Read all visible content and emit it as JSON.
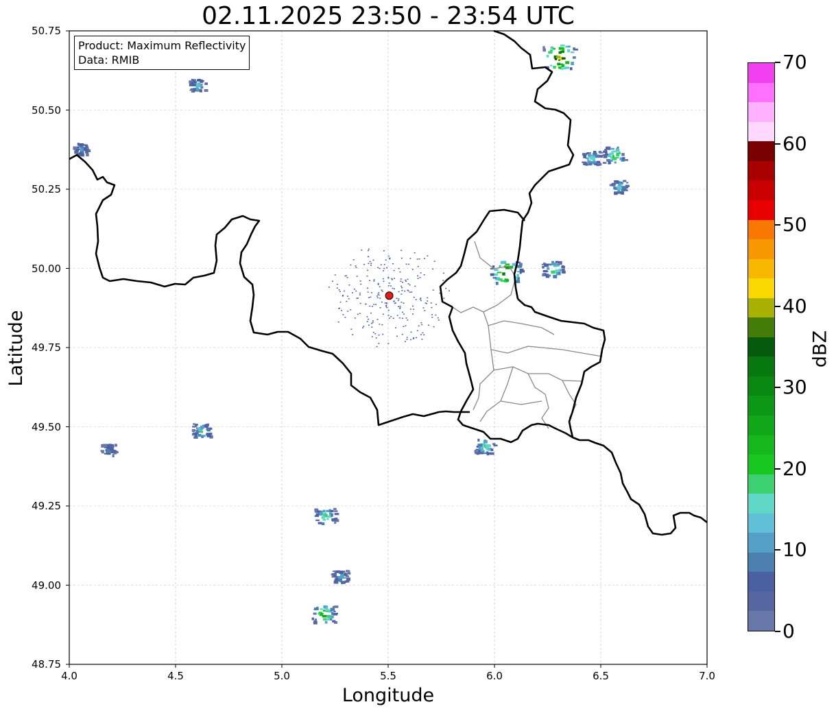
{
  "title": "02.11.2025 23:50 - 23:54 UTC",
  "infobox": {
    "product": "Product: Maximum Reflectivity",
    "source": "Data: RMIB"
  },
  "axes": {
    "xlabel": "Longitude",
    "ylabel": "Latitude",
    "xlim": [
      4.0,
      7.0
    ],
    "ylim": [
      48.75,
      50.75
    ],
    "xticks": [
      "4.0",
      "4.5",
      "5.0",
      "5.5",
      "6.0",
      "6.5",
      "7.0"
    ],
    "yticks": [
      "48.75",
      "49.00",
      "49.25",
      "49.50",
      "49.75",
      "50.00",
      "50.25",
      "50.50",
      "50.75"
    ],
    "grid": true
  },
  "colorbar": {
    "label": "dBZ",
    "range": [
      0,
      70
    ],
    "tick_labels": [
      "0",
      "10",
      "20",
      "30",
      "40",
      "50",
      "60",
      "70"
    ],
    "colors": [
      "#6677a8",
      "#5566a0",
      "#4a60a0",
      "#4a7fb0",
      "#55a0c8",
      "#60c0d8",
      "#60d8c8",
      "#3cd070",
      "#18c820",
      "#14b81c",
      "#10a818",
      "#0c9814",
      "#088810",
      "#06780e",
      "#055a0c",
      "#447c08",
      "#a8b000",
      "#f8d800",
      "#f8b800",
      "#f89800",
      "#f87800",
      "#e80000",
      "#c80000",
      "#a80000",
      "#780000",
      "#ffd8ff",
      "#ffb0ff",
      "#ff70ff",
      "#f040f0"
    ]
  },
  "radar_site": {
    "lon": 5.505,
    "lat": 49.914,
    "color": "#e41a1c"
  },
  "colors": {
    "border_country": "#000000",
    "border_region": "#888888",
    "grid": "#bbbbbb"
  },
  "chart_data": {
    "type": "heatmap",
    "title": "02.11.2025 23:50 - 23:54 UTC",
    "xlabel": "Longitude",
    "ylabel": "Latitude",
    "xlim": [
      4.0,
      7.0
    ],
    "ylim": [
      48.75,
      50.75
    ],
    "colorbar_label": "dBZ",
    "colorbar_range": [
      0,
      70
    ],
    "echo_cells": [
      {
        "lon": 4.6,
        "lat": 50.58,
        "dbz": 15
      },
      {
        "lon": 4.05,
        "lat": 50.38,
        "dbz": 12
      },
      {
        "lon": 6.56,
        "lat": 50.36,
        "dbz": 24
      },
      {
        "lon": 6.45,
        "lat": 50.35,
        "dbz": 18
      },
      {
        "lon": 6.58,
        "lat": 50.26,
        "dbz": 16
      },
      {
        "lon": 6.05,
        "lat": 49.99,
        "dbz": 40
      },
      {
        "lon": 6.27,
        "lat": 50.0,
        "dbz": 22
      },
      {
        "lon": 5.2,
        "lat": 49.22,
        "dbz": 22
      },
      {
        "lon": 5.19,
        "lat": 48.91,
        "dbz": 28
      },
      {
        "lon": 5.27,
        "lat": 49.03,
        "dbz": 14
      },
      {
        "lon": 4.62,
        "lat": 49.49,
        "dbz": 18
      },
      {
        "lon": 4.18,
        "lat": 49.43,
        "dbz": 10
      },
      {
        "lon": 5.95,
        "lat": 49.44,
        "dbz": 20
      },
      {
        "lon": 6.3,
        "lat": 50.67,
        "dbz": 44
      }
    ]
  }
}
